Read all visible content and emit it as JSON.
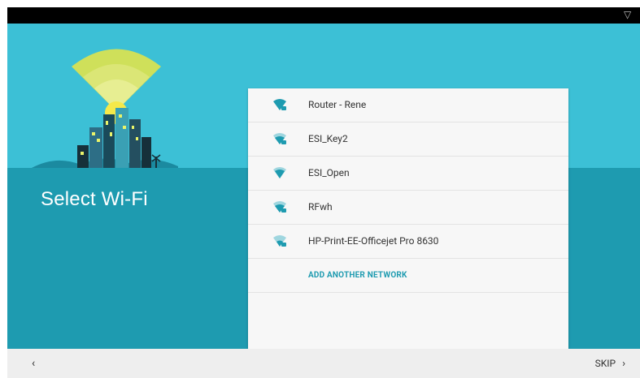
{
  "page": {
    "title": "Select Wi-Fi"
  },
  "networks": [
    {
      "name": "Router - Rene",
      "icon": "wifi-secured-strong-icon"
    },
    {
      "name": "ESI_Key2",
      "icon": "wifi-secured-medium-icon"
    },
    {
      "name": "ESI_Open",
      "icon": "wifi-open-icon"
    },
    {
      "name": "RFwh",
      "icon": "wifi-secured-medium-icon"
    },
    {
      "name": "HP-Print-EE-Officejet Pro 8630",
      "icon": "wifi-secured-weak-icon"
    }
  ],
  "add_network": {
    "label": "ADD ANOTHER NETWORK"
  },
  "bottom_bar": {
    "back_label": "‹",
    "skip_label": "SKIP",
    "skip_chevron": "›"
  },
  "colors": {
    "accent": "#1e9bb0",
    "hero_light": "#3cc0d6",
    "wifi_icon": "#1e9bb0"
  }
}
